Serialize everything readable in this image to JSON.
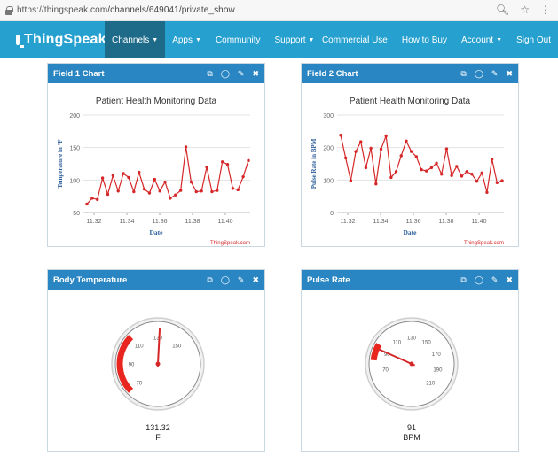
{
  "browser": {
    "url_host": "https://thingspeak.com",
    "url_path": "/channels/649041/private_show",
    "zoom_icon": "zoom-icon",
    "star_icon": "star-icon"
  },
  "nav": {
    "brand": "ThingSpeak",
    "tm": "™",
    "items": [
      {
        "label": "Channels",
        "caret": "▼"
      },
      {
        "label": "Apps",
        "caret": "▼"
      },
      {
        "label": "Community",
        "caret": ""
      },
      {
        "label": "Support",
        "caret": "▼"
      }
    ],
    "right_items": [
      {
        "label": "Commercial Use",
        "caret": ""
      },
      {
        "label": "How to Buy",
        "caret": ""
      },
      {
        "label": "Account",
        "caret": "▼"
      },
      {
        "label": "Sign Out",
        "caret": ""
      }
    ],
    "colors": {
      "bar": "#25a0cf",
      "active": "#1d6a89"
    }
  },
  "panels": {
    "field1": {
      "title": "Field 1 Chart"
    },
    "field2": {
      "title": "Field 2 Chart"
    },
    "body_temp": {
      "title": "Body Temperature"
    },
    "pulse": {
      "title": "Pulse Rate"
    },
    "tool_icons": [
      "external-link-icon",
      "comment-icon",
      "pencil-icon",
      "close-icon"
    ],
    "header_color": "#2a86c2"
  },
  "chart_data": [
    {
      "type": "line",
      "title": "Patient Health Monitoring Data",
      "xlabel": "Date",
      "ylabel": "Temperature in °F",
      "ylim": [
        50,
        200
      ],
      "yticks": [
        "200",
        "150",
        "100",
        "50"
      ],
      "xticks": [
        "11:32",
        "11:34",
        "11:36",
        "11:38",
        "11:40"
      ],
      "credit": "ThingSpeak.com",
      "color": "#d62728",
      "series": [
        {
          "values": [
            63,
            72,
            70,
            103,
            78,
            107,
            83,
            110,
            104,
            82,
            112,
            86,
            80,
            101,
            83,
            97,
            72,
            77,
            84,
            151,
            97,
            82,
            83,
            120,
            82,
            84,
            128,
            124,
            87,
            85,
            105,
            130
          ]
        }
      ]
    },
    {
      "type": "line",
      "title": "Patient Health Monitoring Data",
      "xlabel": "Date",
      "ylabel": "Pulse Rate in BPM",
      "ylim": [
        0,
        300
      ],
      "yticks": [
        "300",
        "200",
        "100",
        "0"
      ],
      "xticks": [
        "11:32",
        "11:34",
        "11:36",
        "11:38",
        "11:40"
      ],
      "credit": "ThingSpeak.com",
      "color": "#d62728",
      "series": [
        {
          "values": [
            238,
            168,
            98,
            188,
            218,
            138,
            198,
            88,
            195,
            236,
            108,
            126,
            175,
            220,
            188,
            172,
            132,
            128,
            138,
            152,
            118,
            196,
            114,
            142,
            112,
            126,
            118,
            96,
            122,
            62,
            164,
            92,
            98
          ]
        }
      ]
    }
  ],
  "gauges": {
    "body_temp": {
      "min": 70,
      "max": 190,
      "value": 131.32,
      "display_value": "131.32",
      "unit": "F",
      "labels": [
        "70",
        "90",
        "110",
        "130",
        "150"
      ],
      "red_from": 70,
      "red_to": 110
    },
    "pulse": {
      "min": 50,
      "max": 210,
      "value": 91,
      "display_value": "91",
      "unit": "BPM",
      "labels": [
        "70",
        "90",
        "110",
        "130",
        "150",
        "170",
        "190",
        "210"
      ],
      "red_from": 80,
      "red_to": 95
    }
  }
}
